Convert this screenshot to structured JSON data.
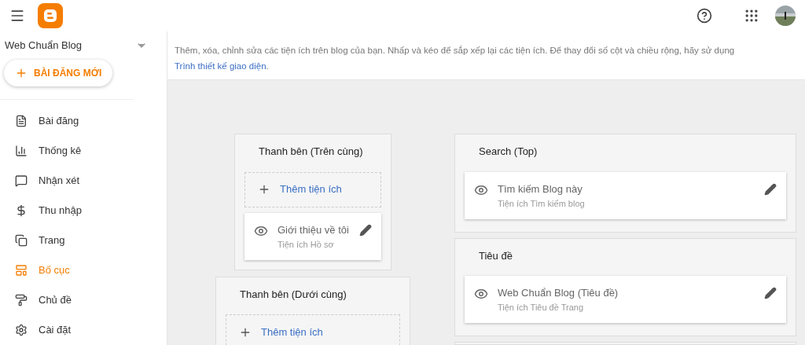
{
  "sidebar": {
    "blog_name": "Web Chuẩn Blog",
    "new_post_button": "BÀI ĐĂNG MỚI",
    "items": [
      {
        "label": "Bài đăng",
        "selected": false
      },
      {
        "label": "Thống kê",
        "selected": false
      },
      {
        "label": "Nhận xét",
        "selected": false
      },
      {
        "label": "Thu nhập",
        "selected": false
      },
      {
        "label": "Trang",
        "selected": false
      },
      {
        "label": "Bố cục",
        "selected": true
      },
      {
        "label": "Chủ đề",
        "selected": false
      },
      {
        "label": "Cài đặt",
        "selected": false
      }
    ]
  },
  "description": {
    "text": "Thêm, xóa, chỉnh sửa các tiện ích trên blog của bạn. Nhấp và kéo để sắp xếp lại các tiện ích. Để thay đổi số cột và chiều rộng, hãy sử dụng",
    "link": "Trình thiết kế giao diện",
    "end": "."
  },
  "layout": {
    "columns": [
      {
        "sections": [
          {
            "title": "Thanh bên (Trên cùng)",
            "add_label": "Thêm tiện ích",
            "widgets": [
              {
                "title": "Giới thiệu về tôi",
                "subtitle": "Tiện ích Hồ sơ"
              }
            ]
          },
          {
            "title": "Thanh bên (Dưới cùng)",
            "add_label": "Thêm tiện ích"
          }
        ]
      },
      {
        "sections": [
          {
            "title": "Search (Top)",
            "widgets": [
              {
                "title": "Tìm kiếm Blog này",
                "subtitle": "Tiện ích Tìm kiếm blog"
              }
            ]
          },
          {
            "title": "Tiêu đề",
            "widgets": [
              {
                "title": "Web Chuẩn Blog (Tiêu đề)",
                "subtitle": "Tiện ích Tiêu đề Trang"
              }
            ]
          }
        ]
      }
    ]
  }
}
